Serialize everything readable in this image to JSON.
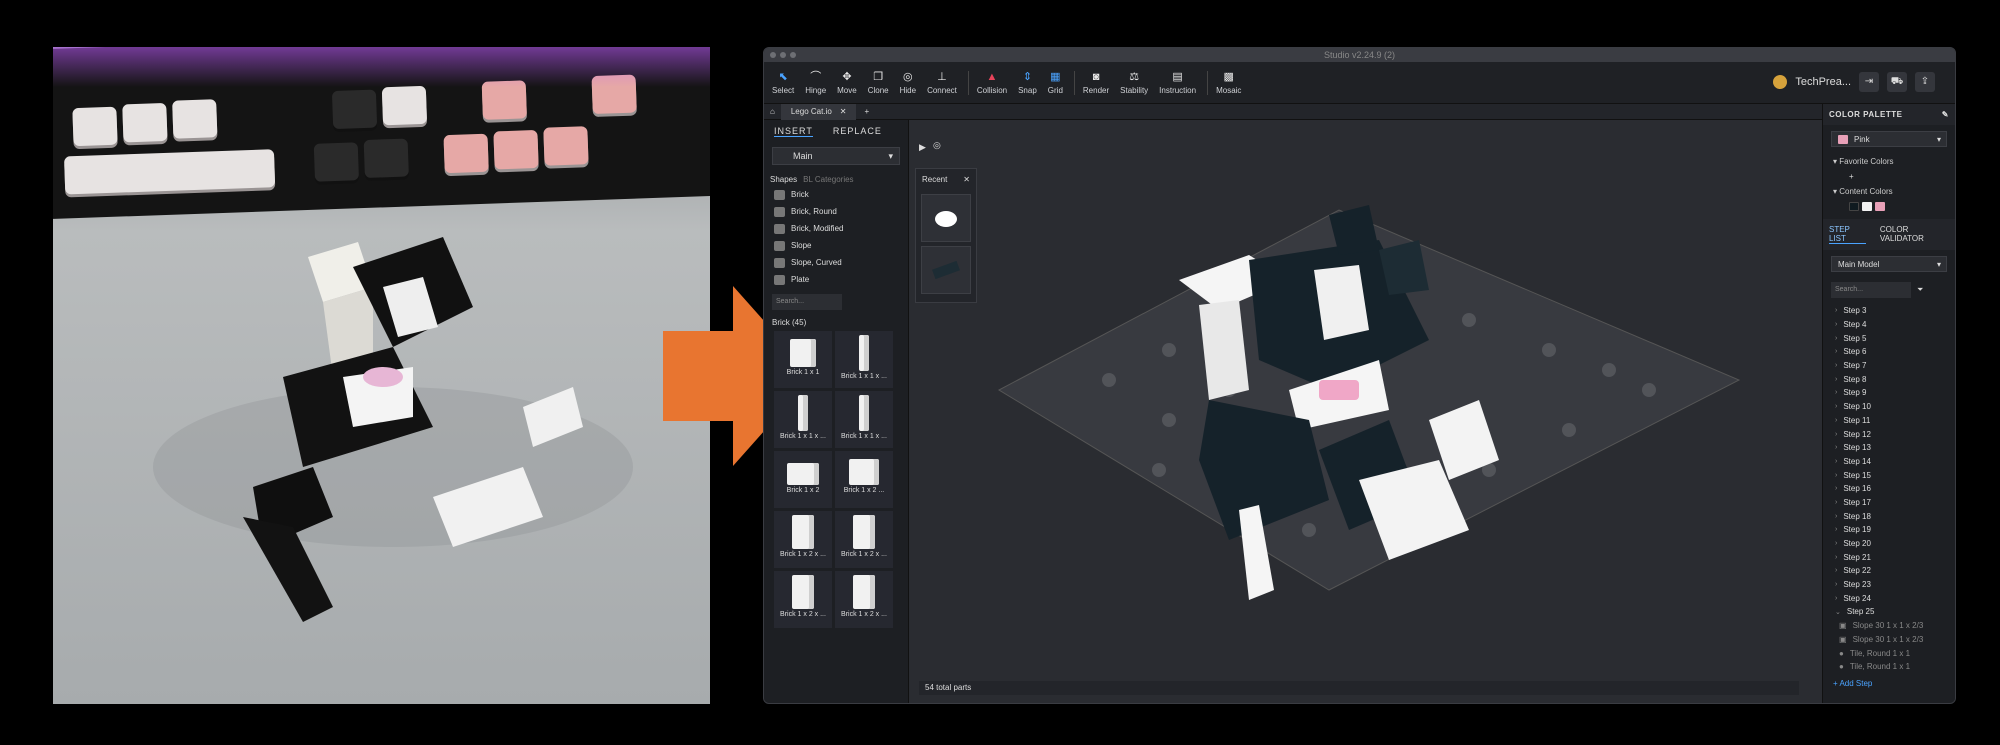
{
  "app": {
    "window_title": "Studio v2.24.9 (2)",
    "toolbar": [
      {
        "label": "Select",
        "icon": "select-icon"
      },
      {
        "label": "Hinge",
        "icon": "hinge-icon"
      },
      {
        "label": "Move",
        "icon": "move-icon"
      },
      {
        "label": "Clone",
        "icon": "clone-icon"
      },
      {
        "label": "Hide",
        "icon": "hide-icon"
      },
      {
        "label": "Connect",
        "icon": "connect-icon"
      },
      {
        "label": "Collision",
        "icon": "collision-icon"
      },
      {
        "label": "Snap",
        "icon": "snap-icon"
      },
      {
        "label": "Grid",
        "icon": "grid-icon"
      },
      {
        "label": "Render",
        "icon": "camera-icon"
      },
      {
        "label": "Stability",
        "icon": "stability-icon"
      },
      {
        "label": "Instruction",
        "icon": "instruction-icon"
      },
      {
        "label": "Mosaic",
        "icon": "mosaic-icon"
      }
    ],
    "username": "TechPrea...",
    "tab": "Lego Cat.io",
    "insert_label": "INSERT",
    "replace_label": "REPLACE",
    "main_dropdown": "Main",
    "shapes_label": "Shapes",
    "bl_categories": "BL Categories",
    "shapes": [
      "Brick",
      "Brick, Round",
      "Brick, Modified",
      "Slope",
      "Slope, Curved",
      "Plate"
    ],
    "search_placeholder": "Search...",
    "brick_section": "Brick (45)",
    "bricks": [
      "Brick 1 x 1",
      "Brick 1 x 1 x ...",
      "Brick 1 x 1 x ...",
      "Brick 1 x 1 x ...",
      "Brick 1 x 2",
      "Brick 1 x 2 ...",
      "Brick 1 x 2 x ...",
      "Brick 1 x 2 x ...",
      "Brick 1 x 2 x ...",
      "Brick 1 x 2 x ..."
    ],
    "recent_label": "Recent",
    "status": "54 total parts"
  },
  "palette": {
    "title": "COLOR PALETTE",
    "selected_color": "Pink",
    "selected_hex": "#e8a0b8",
    "favorite_label": "Favorite Colors",
    "content_label": "Content Colors",
    "content_colors": [
      "#0f1a20",
      "#f2f2f2",
      "#e8a0b8"
    ]
  },
  "steps": {
    "tab_step_list": "STEP LIST",
    "tab_color_validator": "COLOR VALIDATOR",
    "model": "Main Model",
    "search_placeholder": "Search...",
    "items": [
      "Step 3",
      "Step 4",
      "Step 5",
      "Step 6",
      "Step 7",
      "Step 8",
      "Step 9",
      "Step 10",
      "Step 11",
      "Step 12",
      "Step 13",
      "Step 14",
      "Step 15",
      "Step 16",
      "Step 17",
      "Step 18",
      "Step 19",
      "Step 20",
      "Step 21",
      "Step 22",
      "Step 23",
      "Step 24",
      "Step 25"
    ],
    "parts": [
      "Slope 30 1 x 1 x 2/3",
      "Slope 30 1 x 1 x 2/3",
      "Tile, Round 1 x 1",
      "Tile, Round 1 x 1"
    ],
    "add_step": "+ Add Step"
  }
}
